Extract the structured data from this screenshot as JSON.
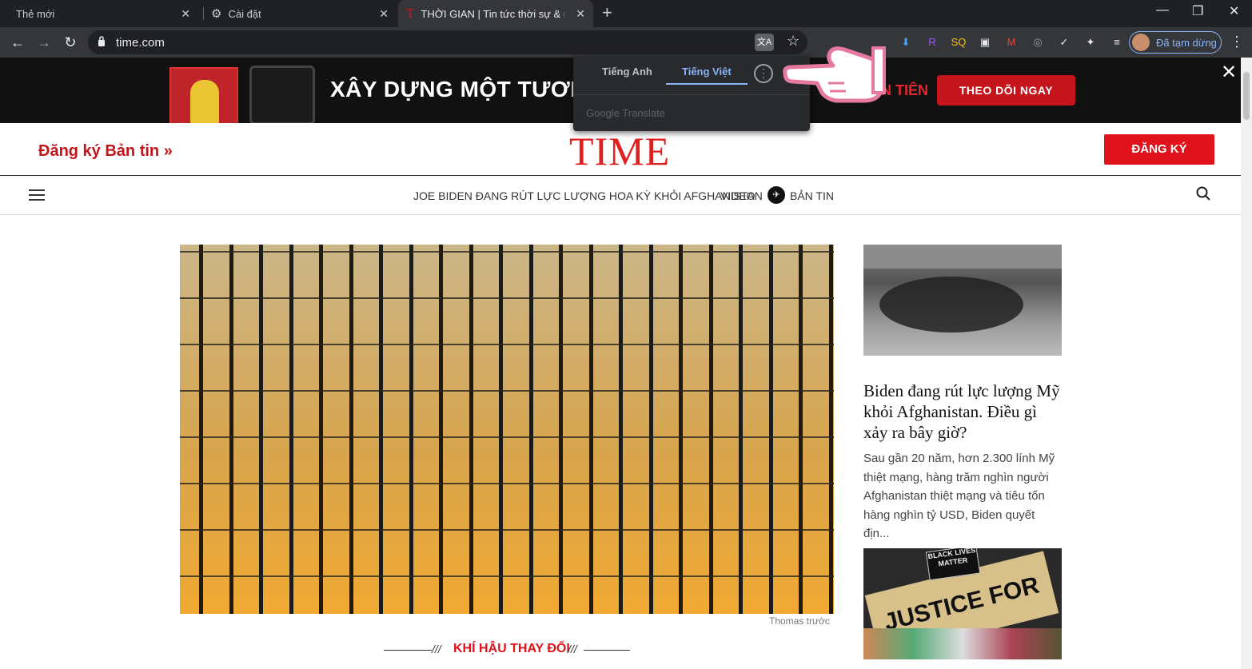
{
  "tabs": [
    {
      "label": "Thẻ mới",
      "close": "✕"
    },
    {
      "label": "Cài đặt",
      "close": "✕"
    },
    {
      "label": "THỜI GIAN | Tin tức thời sự & nổ",
      "close": "✕"
    }
  ],
  "new_tab": "+",
  "window_controls": {
    "minimize": "—",
    "restore": "❐",
    "close": "✕"
  },
  "toolbar": {
    "back": "←",
    "forward": "→",
    "reload": "↻",
    "url": "time.com",
    "star": "☆",
    "profile_label": "Đã tạm dừng",
    "menu": "⋮"
  },
  "extensions": [
    {
      "name": "download-ext-icon",
      "glyph": "⬇",
      "color": "#4aa3ff"
    },
    {
      "name": "r-ext-icon",
      "glyph": "R",
      "color": "#9b59ff"
    },
    {
      "name": "sq-ext-icon",
      "glyph": "SQ",
      "color": "#f4c20d"
    },
    {
      "name": "image-ext-icon",
      "glyph": "▣",
      "color": "#e8eaed"
    },
    {
      "name": "m-ext-icon",
      "glyph": "M",
      "color": "#ea4335"
    },
    {
      "name": "camera-ext-icon",
      "glyph": "◎",
      "color": "#9aa0a6"
    },
    {
      "name": "check-ext-icon",
      "glyph": "✓",
      "color": "#e8eaed"
    },
    {
      "name": "puzzle-ext-icon",
      "glyph": "✦",
      "color": "#e8eaed"
    },
    {
      "name": "playlist-ext-icon",
      "glyph": "≡",
      "color": "#e8eaed"
    }
  ],
  "translate_popup": {
    "source_lang": "Tiếng Anh",
    "target_lang": "Tiếng Việt",
    "more": "⋮",
    "powered_by": "Google Translate"
  },
  "promo": {
    "headline": "XÂY DỰNG MỘT TƯƠNG L",
    "partial": "BẢN TIÊN",
    "follow_button": "THEO DÕI NGAY",
    "close": "✕"
  },
  "masthead": {
    "subscribe_link": "Đăng ký Bản tin »",
    "logo": "TIME",
    "register_button": "ĐĂNG KÝ"
  },
  "nav": {
    "items": [
      "JOE BIDEN ĐANG RÚT LỰC LƯỢNG HOA KỲ KHỎI AFGHANISTAN",
      "VIDEO",
      "BẢN TIN"
    ]
  },
  "hero": {
    "credit": "Thomas trước",
    "section": "KHÍ HẬU THAY ĐỔI"
  },
  "sidebar_article": {
    "title": "Biden đang rút lực lượng Mỹ khỏi Afghanistan. Điều gì xảy ra bây giờ?",
    "description": "Sau gần 20 năm, hơn 2.300 lính Mỹ thiệt mạng, hàng trăm nghìn người Afghanistan thiệt mạng và tiêu tốn hàng nghìn tỷ USD, Biden quyết địn..."
  },
  "second_thumb": {
    "sign_text": "JUSTICE FOR",
    "badge_text": "BLACK LIVES MATTER"
  },
  "colors": {
    "time_red": "#e0121b",
    "chrome_dark": "#202124",
    "accent_blue": "#8ab4f8"
  }
}
